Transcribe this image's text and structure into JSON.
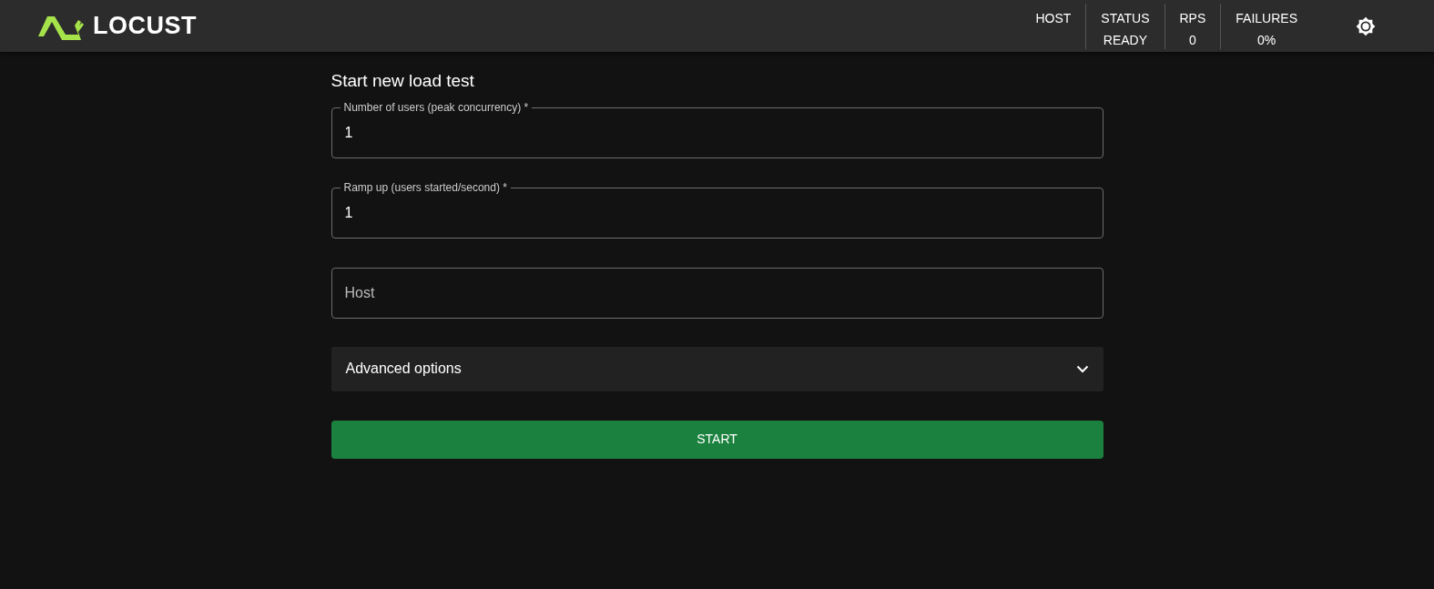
{
  "header": {
    "brand": "LOCUST",
    "stats": [
      {
        "label": "HOST"
      },
      {
        "label": "STATUS",
        "value": "READY"
      },
      {
        "label": "RPS",
        "value": "0"
      },
      {
        "label": "FAILURES",
        "value": "0%"
      }
    ]
  },
  "form": {
    "title": "Start new load test",
    "fields": [
      {
        "label": "Number of users (peak concurrency) *",
        "value": "1"
      },
      {
        "label": "Ramp up (users started/second) *",
        "value": "1"
      },
      {
        "placeholder": "Host"
      }
    ],
    "advanced": {
      "label": "Advanced options",
      "expanded": false
    },
    "submit": "START"
  }
}
